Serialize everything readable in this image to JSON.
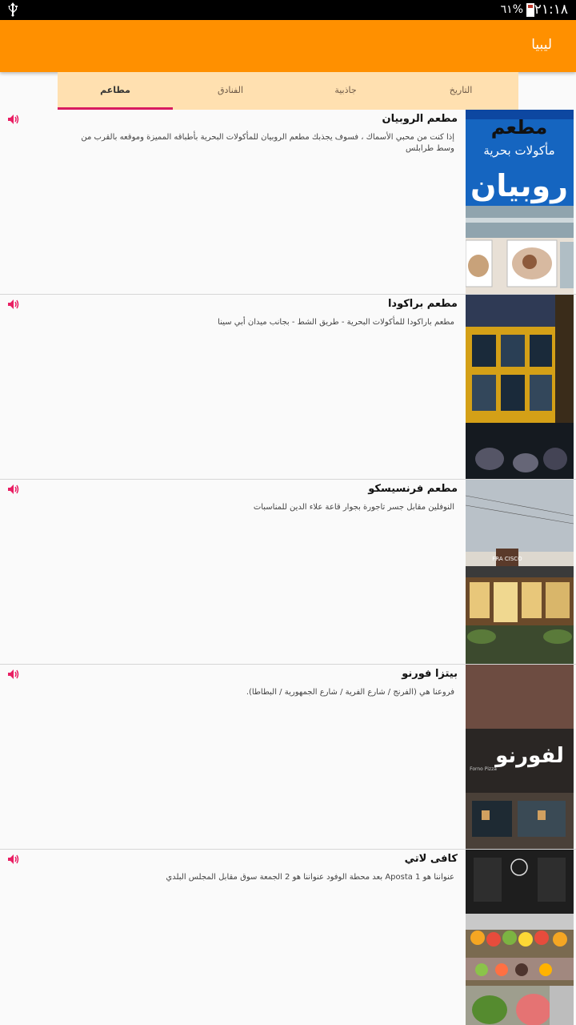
{
  "status_bar": {
    "time": "٢١:١٨",
    "battery": "٦١%",
    "usb_icon": "usb-icon"
  },
  "app_bar": {
    "title": "ليبيا"
  },
  "tabs": [
    {
      "label": "التاريخ"
    },
    {
      "label": "جاذبية"
    },
    {
      "label": "الفنادق"
    },
    {
      "label": "مطاعم",
      "active": true
    }
  ],
  "restaurants": [
    {
      "name": "مطعم الروبيان",
      "description": "إذا كنت من محبي الأسماك ، فسوف يجذبك مطعم الروبيان للمأكولات البحرية بأطباقه المميزة وموقعه بالقرب من وسط طرابلس",
      "sign_text": "مطعم مأكولات بحرية روبيان"
    },
    {
      "name": "مطعم براكودا",
      "description": "مطعم باراكودا للمأكولات البحرية - طريق الشط - بجانب ميدان أبي سينا"
    },
    {
      "name": "مطعم فرنسيسكو",
      "description": "النوفلين مقابل جسر تاجورة بجوار قاعة علاء الدين للمناسبات",
      "sign_text": "FRA CISCO"
    },
    {
      "name": "بيتزا فورنو",
      "description": "فروعنا هي (الفرنج / شارع الفرية / شارع الجمهورية / البطاطا).",
      "sign_text": "لفورنو",
      "sub_sign_text": "Forno Pizza"
    },
    {
      "name": "كافى لاتي",
      "description": "عنواننا هو Aposta 1 بعد محطة الوفود عنواننا هو 2 الجمعة سوق مقابل المجلس البلدي"
    }
  ],
  "colors": {
    "app_bar": "#ff9000",
    "tab_bar": "#ffe0b0",
    "tab_indicator": "#d81b60",
    "speaker_icon": "#e91e63"
  }
}
